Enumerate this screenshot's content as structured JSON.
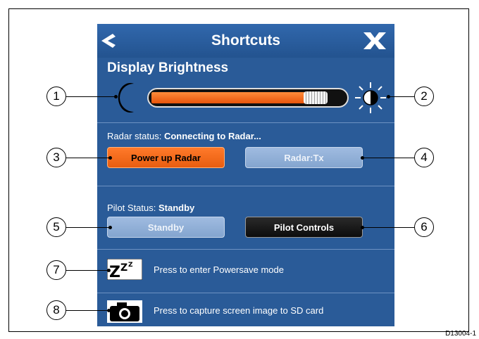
{
  "header": {
    "title": "Shortcuts",
    "back_icon": "chevron-left-icon",
    "close_icon": "close-x-icon"
  },
  "brightness": {
    "label": "Display Brightness",
    "level": 0.9,
    "low_icon": "moon-icon",
    "high_icon": "sun-icon"
  },
  "radar": {
    "status_prefix": "Radar status:",
    "status_value": "Connecting to Radar...",
    "power_button": "Power up Radar",
    "tx_button": "Radar:Tx"
  },
  "pilot": {
    "status_prefix": "Pilot Status:",
    "status_value": "Standby",
    "standby_button": "Standby",
    "controls_button": "Pilot Controls"
  },
  "powersave": {
    "icon": "sleep-zzz-icon",
    "text": "Press to enter Powersave mode"
  },
  "screenshot": {
    "icon": "camera-icon",
    "text": "Press to capture screen image to SD card"
  },
  "callouts": [
    "1",
    "2",
    "3",
    "4",
    "5",
    "6",
    "7",
    "8"
  ],
  "figure_id": "D13004-1",
  "colors": {
    "panel": "#2a5b98",
    "accent_orange": "#f26a1b",
    "disabled_button": "#8fb0d8",
    "dark_button": "#111111"
  }
}
